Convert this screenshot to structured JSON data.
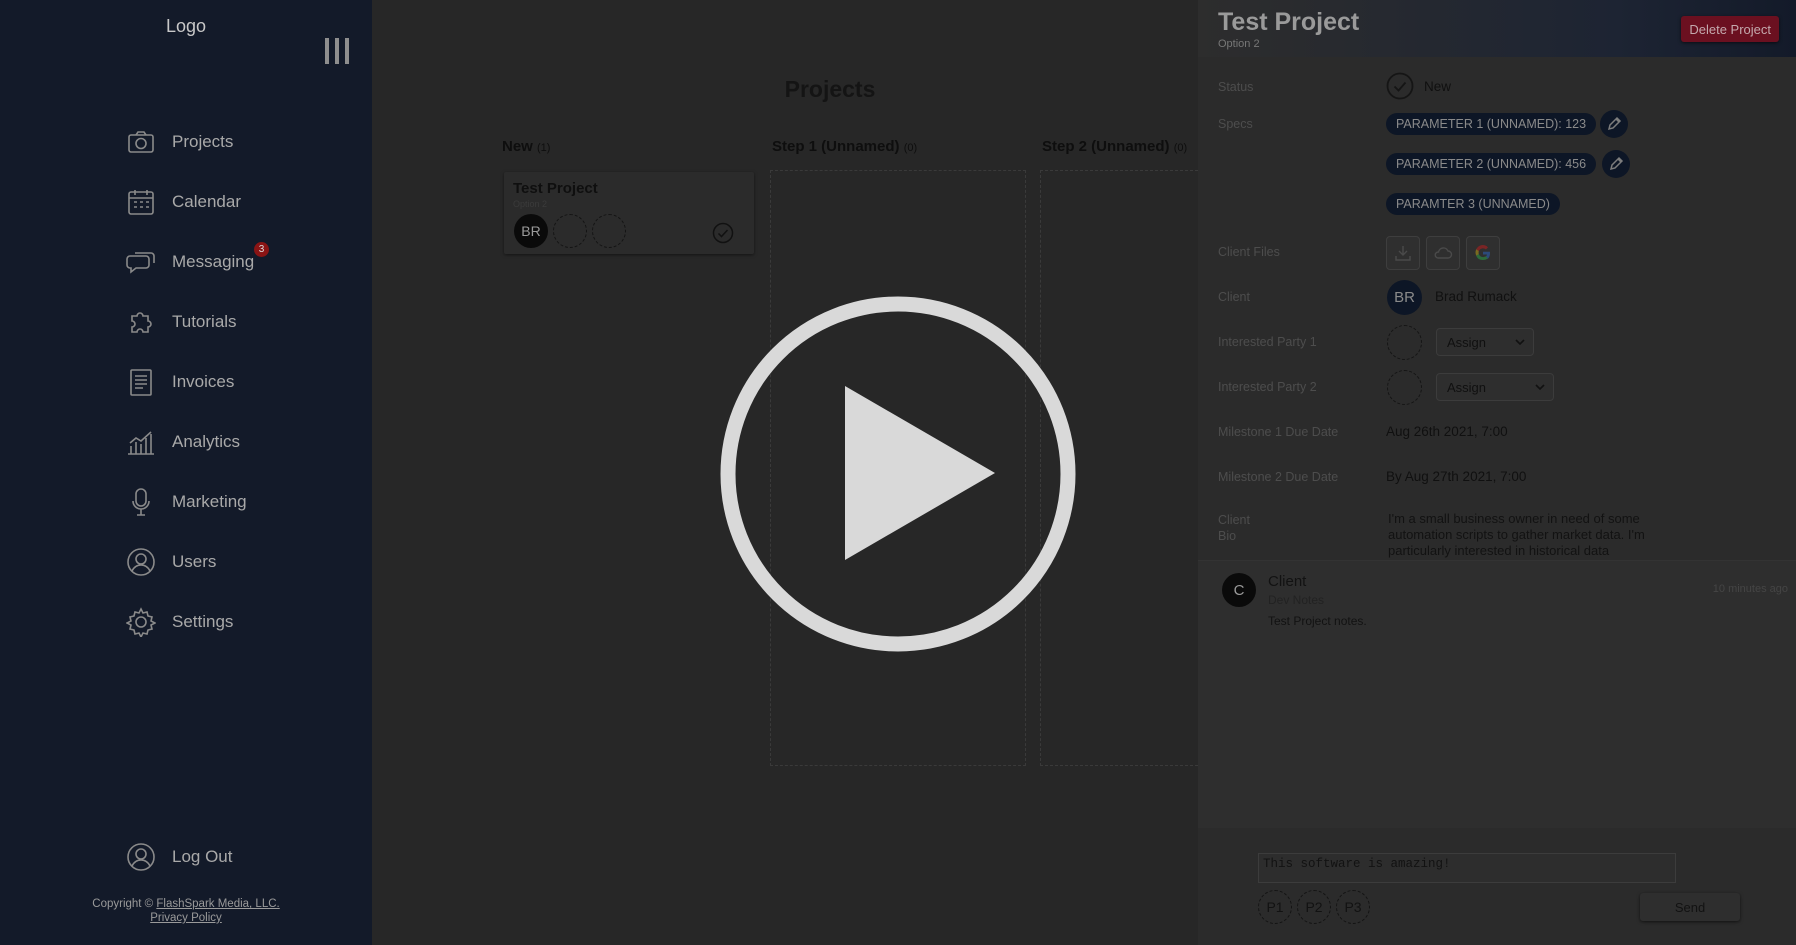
{
  "sidebar": {
    "logo": "Logo",
    "items": [
      {
        "label": "Projects",
        "icon": "camera-icon"
      },
      {
        "label": "Calendar",
        "icon": "calendar-icon"
      },
      {
        "label": "Messaging",
        "icon": "chat-icon",
        "badge": "3"
      },
      {
        "label": "Tutorials",
        "icon": "puzzle-icon"
      },
      {
        "label": "Invoices",
        "icon": "document-icon"
      },
      {
        "label": "Analytics",
        "icon": "chart-icon"
      },
      {
        "label": "Marketing",
        "icon": "microphone-icon"
      },
      {
        "label": "Users",
        "icon": "user-icon"
      },
      {
        "label": "Settings",
        "icon": "gear-icon"
      }
    ],
    "logout": "Log Out",
    "copyright_prefix": "Copyright ©",
    "company": "FlashSpark Media, LLC.",
    "privacy": "Privacy Policy"
  },
  "board": {
    "title": "Projects",
    "columns": [
      {
        "name": "New",
        "count": "(1)"
      },
      {
        "name": "Step 1 (Unnamed)",
        "count": "(0)"
      },
      {
        "name": "Step 2 (Unnamed)",
        "count": "(0)"
      }
    ],
    "card": {
      "title": "Test Project",
      "subtitle": "Option 2",
      "avatar": "BR"
    }
  },
  "panel": {
    "title": "Test Project",
    "subtitle": "Option 2",
    "delete": "Delete Project",
    "labels": {
      "status": "Status",
      "specs": "Specs",
      "client_files": "Client Files",
      "client": "Client",
      "party1": "Interested Party 1",
      "party2": "Interested Party 2",
      "m1": "Milestone 1 Due Date",
      "m2": "Milestone 2 Due Date",
      "bio_1": "Client",
      "bio_2": "Bio"
    },
    "status": "New",
    "specs": [
      "PARAMETER 1 (UNNAMED): 123",
      "PARAMETER 2 (UNNAMED): 456",
      "PARAMTER 3 (UNNAMED)"
    ],
    "client_initials": "BR",
    "client_name": "Brad Rumack",
    "assign": "Assign",
    "m1_date": "Aug 26th 2021, 7:00",
    "m2_date": "By Aug 27th 2021, 7:00",
    "bio": "I'm a small business owner in need of some automation scripts to gather market data. I'm particularly interested in historical data"
  },
  "notes": {
    "avatar": "C",
    "author": "Client",
    "category": "Dev Notes",
    "text": "Test Project notes.",
    "time": "10 minutes ago"
  },
  "composer": {
    "message": "This software is amazing!",
    "p": [
      "P1",
      "P2",
      "P3"
    ],
    "send": "Send"
  },
  "colors": {
    "sidebar": "#131a29",
    "delete": "#6b1020",
    "overlay": "#d9d9d9"
  }
}
